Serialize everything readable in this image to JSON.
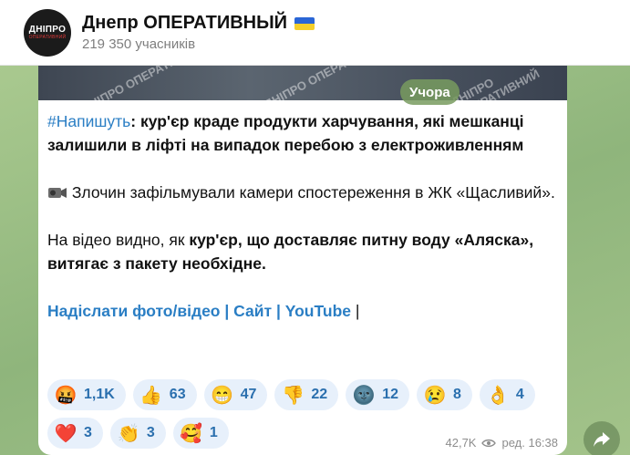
{
  "header": {
    "avatar_line1": "ДНІПРО",
    "avatar_line2": "ОПЕРАТИВНИЙ",
    "title": "Днепр ОПЕРАТИВНЫЙ",
    "subscribers": "219 350 учасників"
  },
  "media": {
    "watermarks": [
      "ДНІПРО ОПЕРАТИВНИЙ",
      "ДНІПРО ОПЕРАТИВНИЙ",
      "ДНІПРО ОПЕРАТИВНИЙ"
    ]
  },
  "date_pill": "Учора",
  "post": {
    "hashtag": "#Напишуть",
    "p1_rest": ": кур'єр краде продукти харчування, які мешканці залишили в ліфті на випадок перебою з електроживленням",
    "p2": " Злочин зафільмували камери спостереження в ЖК «Щасливий».",
    "p3_a": "На відео видно, як ",
    "p3_b": "кур'єр, що доставляє питну воду «Аляска», витягає з пакету необхідне.",
    "link_photo": "Надіслати фото/відео",
    "link_site": "Сайт",
    "link_youtube": "YouTube",
    "separator": "|"
  },
  "reactions": [
    {
      "icon": "angry-face-icon",
      "emoji": "🤬",
      "count": "1,1K"
    },
    {
      "icon": "thumbs-up-icon",
      "emoji": "👍",
      "count": "63"
    },
    {
      "icon": "grinning-face-icon",
      "emoji": "😁",
      "count": "47"
    },
    {
      "icon": "thumbs-down-icon",
      "emoji": "👎",
      "count": "22"
    },
    {
      "icon": "new-moon-face-icon",
      "emoji": "🌚",
      "count": "12"
    },
    {
      "icon": "crying-face-icon",
      "emoji": "😢",
      "count": "8"
    },
    {
      "icon": "ok-hand-icon",
      "emoji": "👌",
      "count": "4"
    },
    {
      "icon": "red-heart-icon",
      "emoji": "❤️",
      "count": "3"
    },
    {
      "icon": "clapping-hands-icon",
      "emoji": "👏",
      "count": "3"
    },
    {
      "icon": "smiling-face-with-hearts-icon",
      "emoji": "🥰",
      "count": "1"
    }
  ],
  "meta": {
    "views": "42,7K",
    "edited_time": "ред. 16:38"
  },
  "colors": {
    "link": "#2a7ec4",
    "reaction_bg": "#e7f0fb",
    "flag_blue": "#2a66d6",
    "flag_yellow": "#f5cf2b"
  }
}
